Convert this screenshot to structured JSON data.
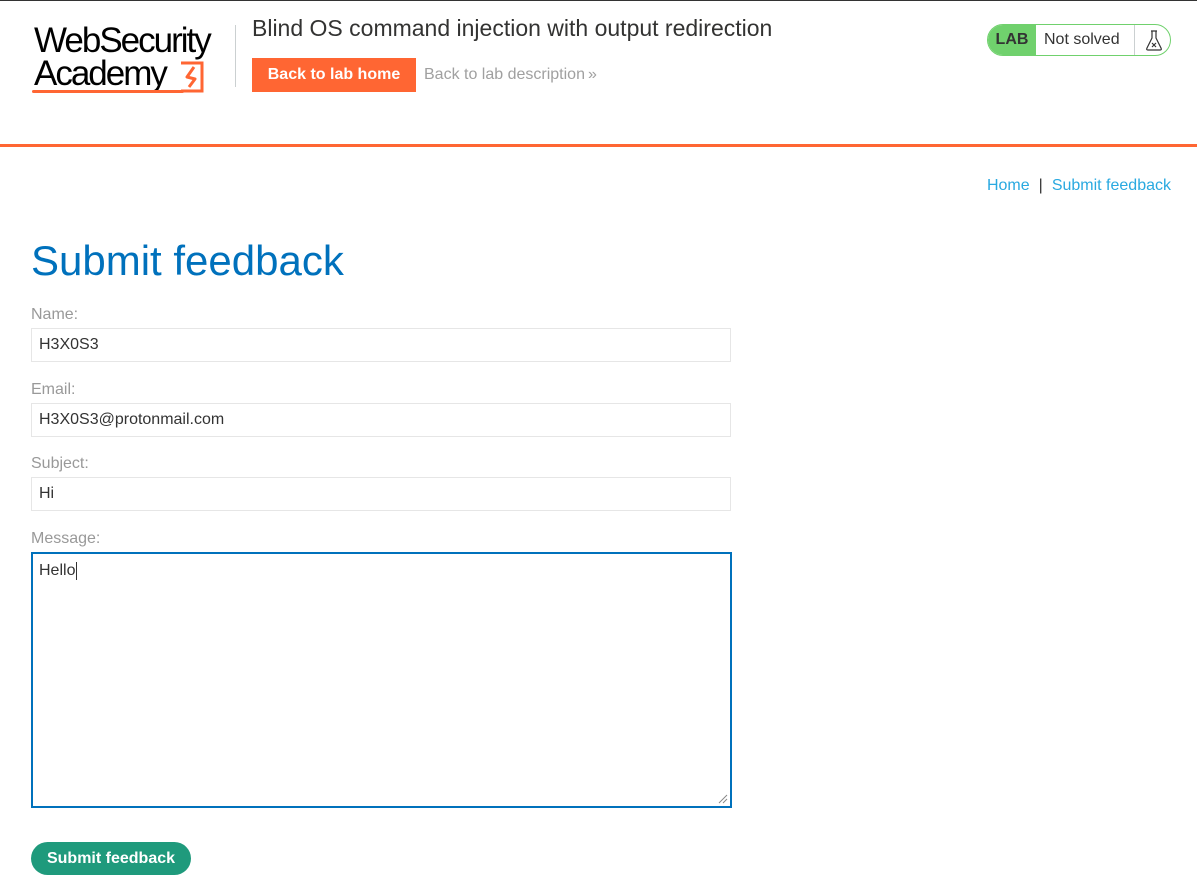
{
  "logo": {
    "line1": "WebSecurity",
    "line2": "Academy"
  },
  "header": {
    "lab_title": "Blind OS command injection with output redirection",
    "back_home_label": "Back to lab home",
    "back_description_label": "Back to lab description"
  },
  "lab_status": {
    "badge": "LAB",
    "status": "Not solved",
    "icon": "flask-icon"
  },
  "breadcrumb": {
    "home": "Home",
    "separator": "|",
    "current": "Submit feedback"
  },
  "page_title": "Submit feedback",
  "form": {
    "name_label": "Name:",
    "name_value": "H3X0S3",
    "email_label": "Email:",
    "email_value": "H3X0S3@protonmail.com",
    "subject_label": "Subject:",
    "subject_value": "Hi",
    "message_label": "Message:",
    "message_value": "Hello",
    "submit_label": "Submit feedback"
  },
  "colors": {
    "accent_orange": "#ff6633",
    "title_blue": "#0071bc",
    "link_blue": "#29a9e0",
    "lab_green": "#70d16d",
    "submit_green": "#1f9a7c"
  }
}
